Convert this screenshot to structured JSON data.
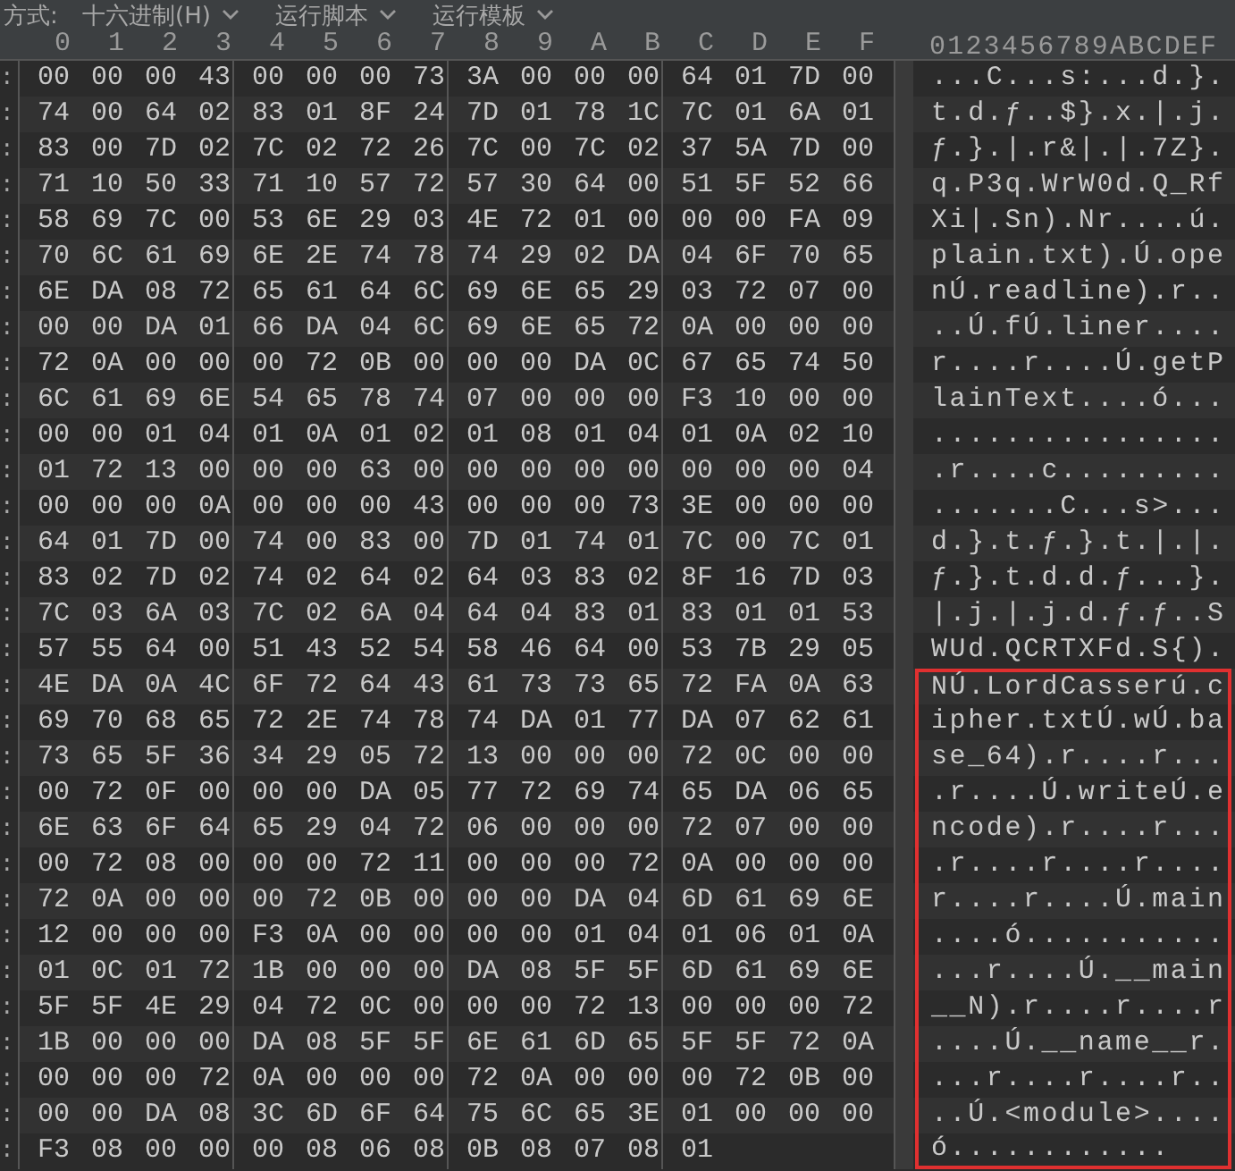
{
  "toolbar": {
    "label": "方式:",
    "dropdowns": [
      {
        "label": "十六进制(H)"
      },
      {
        "label": "运行脚本"
      },
      {
        "label": "运行模板"
      }
    ]
  },
  "columns": {
    "hex": [
      "0",
      "1",
      "2",
      "3",
      "4",
      "5",
      "6",
      "7",
      "8",
      "9",
      "A",
      "B",
      "C",
      "D",
      "E",
      "F"
    ],
    "ascii": "0123456789ABCDEF"
  },
  "rows": [
    {
      "offset": ":",
      "groups": [
        "00 00 00 43",
        "00 00 00 73",
        "3A 00 00 00",
        "64 01 7D 00"
      ],
      "ascii": "...C...s:...d.}.",
      "boxed": false
    },
    {
      "offset": ":",
      "groups": [
        "74 00 64 02",
        "83 01 8F 24",
        "7D 01 78 1C",
        "7C 01 6A 01"
      ],
      "ascii": "t.d.ƒ..$}.x.|.j.",
      "boxed": false
    },
    {
      "offset": ":",
      "groups": [
        "83 00 7D 02",
        "7C 02 72 26",
        "7C 00 7C 02",
        "37 5A 7D 00"
      ],
      "ascii": "ƒ.}.|.r&|.|.7Z}.",
      "boxed": false
    },
    {
      "offset": ":",
      "groups": [
        "71 10 50 33",
        "71 10 57 72",
        "57 30 64 00",
        "51 5F 52 66"
      ],
      "ascii": "q.P3q.WrW0d.Q_Rf",
      "boxed": false
    },
    {
      "offset": ":",
      "groups": [
        "58 69 7C 00",
        "53 6E 29 03",
        "4E 72 01 00",
        "00 00 FA 09"
      ],
      "ascii": "Xi|.Sn).Nr....ú.",
      "boxed": false
    },
    {
      "offset": ":",
      "groups": [
        "70 6C 61 69",
        "6E 2E 74 78",
        "74 29 02 DA",
        "04 6F 70 65"
      ],
      "ascii": "plain.txt).Ú.ope",
      "boxed": false
    },
    {
      "offset": ":",
      "groups": [
        "6E DA 08 72",
        "65 61 64 6C",
        "69 6E 65 29",
        "03 72 07 00"
      ],
      "ascii": "nÚ.readline).r..",
      "boxed": false
    },
    {
      "offset": ":",
      "groups": [
        "00 00 DA 01",
        "66 DA 04 6C",
        "69 6E 65 72",
        "0A 00 00 00"
      ],
      "ascii": "..Ú.fÚ.liner....",
      "boxed": false
    },
    {
      "offset": ":",
      "groups": [
        "72 0A 00 00",
        "00 72 0B 00",
        "00 00 DA 0C",
        "67 65 74 50"
      ],
      "ascii": "r....r....Ú.getP",
      "boxed": false
    },
    {
      "offset": ":",
      "groups": [
        "6C 61 69 6E",
        "54 65 78 74",
        "07 00 00 00",
        "F3 10 00 00"
      ],
      "ascii": "lainText....ó...",
      "boxed": false
    },
    {
      "offset": ":",
      "groups": [
        "00 00 01 04",
        "01 0A 01 02",
        "01 08 01 04",
        "01 0A 02 10"
      ],
      "ascii": "................",
      "boxed": false
    },
    {
      "offset": ":",
      "groups": [
        "01 72 13 00",
        "00 00 63 00",
        "00 00 00 00",
        "00 00 00 04"
      ],
      "ascii": ".r....c.........",
      "boxed": false
    },
    {
      "offset": ":",
      "groups": [
        "00 00 00 0A",
        "00 00 00 43",
        "00 00 00 73",
        "3E 00 00 00"
      ],
      "ascii": ".......C...s>...",
      "boxed": false
    },
    {
      "offset": ":",
      "groups": [
        "64 01 7D 00",
        "74 00 83 00",
        "7D 01 74 01",
        "7C 00 7C 01"
      ],
      "ascii": "d.}.t.ƒ.}.t.|.|.",
      "boxed": false
    },
    {
      "offset": ":",
      "groups": [
        "83 02 7D 02",
        "74 02 64 02",
        "64 03 83 02",
        "8F 16 7D 03"
      ],
      "ascii": "ƒ.}.t.d.d.ƒ...}.",
      "boxed": false
    },
    {
      "offset": ":",
      "groups": [
        "7C 03 6A 03",
        "7C 02 6A 04",
        "64 04 83 01",
        "83 01 01 53"
      ],
      "ascii": "|.j.|.j.d.ƒ.ƒ..S",
      "boxed": false
    },
    {
      "offset": ":",
      "groups": [
        "57 55 64 00",
        "51 43 52 54",
        "58 46 64 00",
        "53 7B 29 05"
      ],
      "ascii": "WUd.QCRTXFd.S{).",
      "boxed": false
    },
    {
      "offset": ":",
      "groups": [
        "4E DA 0A 4C",
        "6F 72 64 43",
        "61 73 73 65",
        "72 FA 0A 63"
      ],
      "ascii": "NÚ.LordCasserú.c",
      "boxed": true
    },
    {
      "offset": ":",
      "groups": [
        "69 70 68 65",
        "72 2E 74 78",
        "74 DA 01 77",
        "DA 07 62 61"
      ],
      "ascii": "ipher.txtÚ.wÚ.ba",
      "boxed": true
    },
    {
      "offset": ":",
      "groups": [
        "73 65 5F 36",
        "34 29 05 72",
        "13 00 00 00",
        "72 0C 00 00"
      ],
      "ascii": "se_64).r....r...",
      "boxed": true
    },
    {
      "offset": ":",
      "groups": [
        "00 72 0F 00",
        "00 00 DA 05",
        "77 72 69 74",
        "65 DA 06 65"
      ],
      "ascii": ".r....Ú.writeÚ.e",
      "boxed": true
    },
    {
      "offset": ":",
      "groups": [
        "6E 63 6F 64",
        "65 29 04 72",
        "06 00 00 00",
        "72 07 00 00"
      ],
      "ascii": "ncode).r....r...",
      "boxed": true
    },
    {
      "offset": ":",
      "groups": [
        "00 72 08 00",
        "00 00 72 11",
        "00 00 00 72",
        "0A 00 00 00"
      ],
      "ascii": ".r....r....r....",
      "boxed": true
    },
    {
      "offset": ":",
      "groups": [
        "72 0A 00 00",
        "00 72 0B 00",
        "00 00 DA 04",
        "6D 61 69 6E"
      ],
      "ascii": "r....r....Ú.main",
      "boxed": true
    },
    {
      "offset": ":",
      "groups": [
        "12 00 00 00",
        "F3 0A 00 00",
        "00 00 01 04",
        "01 06 01 0A"
      ],
      "ascii": "....ó...........",
      "boxed": true
    },
    {
      "offset": ":",
      "groups": [
        "01 0C 01 72",
        "1B 00 00 00",
        "DA 08 5F 5F",
        "6D 61 69 6E"
      ],
      "ascii": "...r....Ú.__main",
      "boxed": true
    },
    {
      "offset": ":",
      "groups": [
        "5F 5F 4E 29",
        "04 72 0C 00",
        "00 00 72 13",
        "00 00 00 72"
      ],
      "ascii": "__N).r....r....r",
      "boxed": true
    },
    {
      "offset": ":",
      "groups": [
        "1B 00 00 00",
        "DA 08 5F 5F",
        "6E 61 6D 65",
        "5F 5F 72 0A"
      ],
      "ascii": "....Ú.__name__r.",
      "boxed": true
    },
    {
      "offset": ":",
      "groups": [
        "00 00 00 72",
        "0A 00 00 00",
        "72 0A 00 00",
        "00 72 0B 00"
      ],
      "ascii": "...r....r....r..",
      "boxed": true
    },
    {
      "offset": ":",
      "groups": [
        "00 00 DA 08",
        "3C 6D 6F 64",
        "75 6C 65 3E",
        "01 00 00 00"
      ],
      "ascii": "..Ú.<module>....",
      "boxed": true
    },
    {
      "offset": ":",
      "groups": [
        "F3 08 00 00",
        "00 08 06 08",
        "0B 08 07 08",
        "01"
      ],
      "ascii": "ó............",
      "boxed": true
    }
  ]
}
